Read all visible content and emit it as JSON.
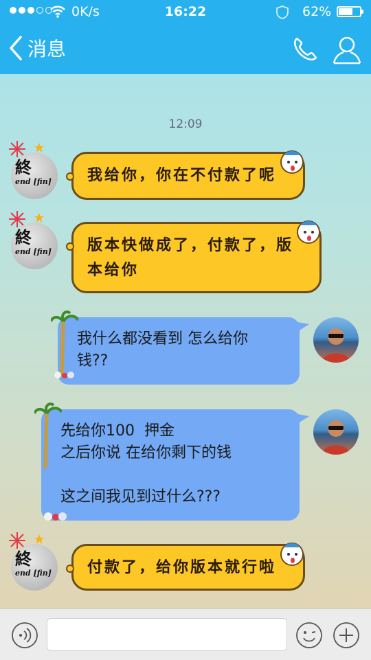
{
  "status_bar": {
    "network_speed": "0K/s",
    "time": "16:22",
    "battery_percent": "62%",
    "battery_level": 0.62
  },
  "header": {
    "back_label": "消息",
    "call_icon": "phone-icon",
    "profile_icon": "person-icon",
    "color": "#27b1ef"
  },
  "timestamp": "12:09",
  "avatars": {
    "other_avatar_text": "終",
    "other_avatar_sub": "end [fin]"
  },
  "messages": [
    {
      "side": "left",
      "style": "yellow",
      "lines": [
        "我给你，你在不付款了呢"
      ]
    },
    {
      "side": "left",
      "style": "yellow",
      "lines": [
        "版本快做成了，付款了，版",
        "本给你"
      ]
    },
    {
      "side": "right",
      "style": "blue",
      "lines": [
        "我什么都没看到 怎么给你",
        "钱??"
      ]
    },
    {
      "side": "right",
      "style": "blue",
      "lines": [
        "先给你100  押金",
        "之后你说 在给你剩下的钱",
        "",
        "这之间我见到过什么???"
      ]
    },
    {
      "side": "left",
      "style": "yellow",
      "lines": [
        "付款了，给你版本就行啦"
      ]
    }
  ],
  "input_bar": {
    "placeholder": "",
    "voice_icon": "voice-icon",
    "emoji_icon": "emoji-icon",
    "plus_icon": "plus-icon"
  }
}
